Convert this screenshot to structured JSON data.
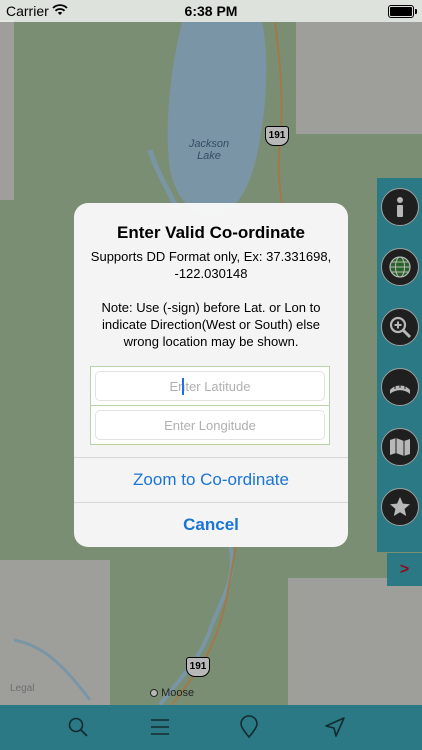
{
  "status_bar": {
    "carrier": "Carrier",
    "time": "6:38 PM"
  },
  "map": {
    "lake_label": "Jackson Lake",
    "route_shield_top": "191",
    "route_shield_bottom": "191",
    "town_label": "Moose",
    "legal_label": "Legal"
  },
  "alert": {
    "title": "Enter Valid Co-ordinate",
    "message_line1": "Supports DD Format only, Ex: 37.331698, -122.030148",
    "message_line2": "Note: Use (-sign) before Lat. or Lon to indicate Direction(West or South) else wrong location may be shown.",
    "latitude_placeholder": "Enter Latitude",
    "longitude_placeholder": "Enter Longitude",
    "primary_action": "Zoom to Co-ordinate",
    "cancel_action": "Cancel"
  },
  "side_panel": {
    "icons": [
      "info-icon",
      "globe-icon",
      "zoom-in-icon",
      "ruler-icon",
      "map-icon",
      "star-icon"
    ],
    "expand_label": ">"
  },
  "bottom_bar": {
    "icons": [
      "search-icon",
      "menu-icon",
      "location-pin-icon",
      "navigation-arrow-icon"
    ]
  },
  "colors": {
    "accent_teal": "#3ba8b8",
    "action_blue": "#1a74d6",
    "map_green": "#a9c5a0",
    "water_blue": "#a8cfe6",
    "expand_red": "#c8102e"
  }
}
